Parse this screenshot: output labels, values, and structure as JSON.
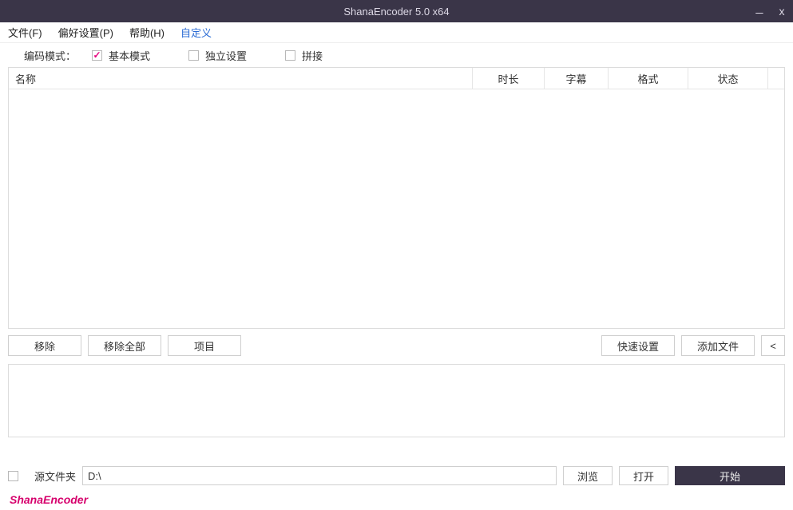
{
  "titlebar": {
    "title": "ShanaEncoder 5.0 x64"
  },
  "menu": {
    "file": "文件(F)",
    "pref": "偏好设置(P)",
    "help": "帮助(H)",
    "custom": "自定义"
  },
  "mode": {
    "label": "编码模式：",
    "basic": "基本模式",
    "independent": "独立设置",
    "concat": "拼接"
  },
  "table": {
    "headers": {
      "name": "名称",
      "duration": "时长",
      "subtitle": "字幕",
      "format": "格式",
      "status": "状态"
    },
    "rows": []
  },
  "buttons": {
    "remove": "移除",
    "remove_all": "移除全部",
    "project": "项目",
    "quick_set": "快速设置",
    "add_file": "添加文件",
    "collapse": "<"
  },
  "output": {
    "source_folder_label": "源文件夹",
    "path_value": "D:\\",
    "browse": "浏览",
    "open": "打开",
    "start": "开始"
  },
  "footer": {
    "brand": "ShanaEncoder"
  }
}
